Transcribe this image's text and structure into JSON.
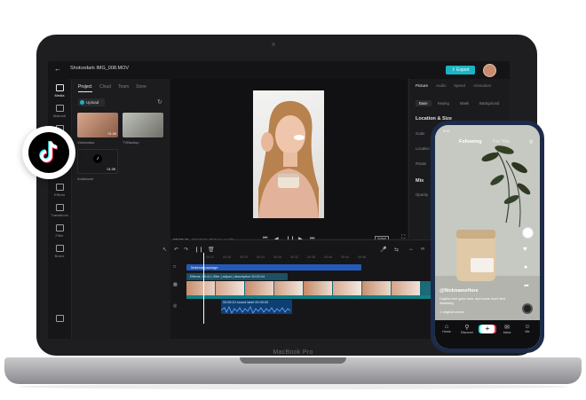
{
  "editor": {
    "file_title": "Shotcedark IMG_008.MOV",
    "export_label": "Export",
    "media_tabs": [
      "Project",
      "Cloud",
      "Team",
      "Store"
    ],
    "upload_label": "Upload",
    "media_items": [
      {
        "label": "Videoclass",
        "duration": "01:36"
      },
      {
        "label": "TVBackup",
        "duration": ""
      },
      {
        "label": "Audioload",
        "duration": "01:39"
      }
    ],
    "rail_items": [
      "Media",
      "Material",
      "Text",
      "Effects",
      "Transitions",
      "Filter",
      "Brand"
    ],
    "right_tabs": [
      "Picture",
      "Audio",
      "Speed",
      "Animation"
    ],
    "right_subtabs": [
      "Base",
      "Keying",
      "Mask",
      "Background"
    ],
    "section_location": "Location & Size",
    "location_labels": [
      "Scale",
      "Location",
      "Rotate"
    ],
    "section_mix": "Mix",
    "mix_labels": [
      "Opacity"
    ],
    "time_current": "00:00:45",
    "time_total": "00:07:00",
    "preview_quality": "Picture quality",
    "ratio_label": "Adapt",
    "ruler_ticks": [
      "00:12",
      "00:16",
      "00:20",
      "00:24",
      "00:28",
      "00:32",
      "00:36",
      "00:40",
      "00:44",
      "00:48"
    ],
    "tracks": {
      "text": "Material package",
      "effects": "Effects > 0:41  |  filter  |  adjust  |  description",
      "effects_time": "00:00:04",
      "audio": "00:05:10  sound label  00:40:00"
    }
  },
  "laptop_brand": "MacBook Pro",
  "phone": {
    "time": "9:41",
    "tabs": [
      "Following",
      "For You"
    ],
    "username": "@NicknameHere",
    "caption": "Caption text goes here, and some more text #hashtag",
    "sound": "♫ original sound",
    "nav": [
      "Home",
      "Discover",
      "",
      "Inbox",
      "Me"
    ]
  },
  "colors": {
    "accent": "#1bb4c4",
    "text_track": "#2459b8",
    "video_track": "#1a6a7a",
    "audio_track": "#0f3f72"
  }
}
